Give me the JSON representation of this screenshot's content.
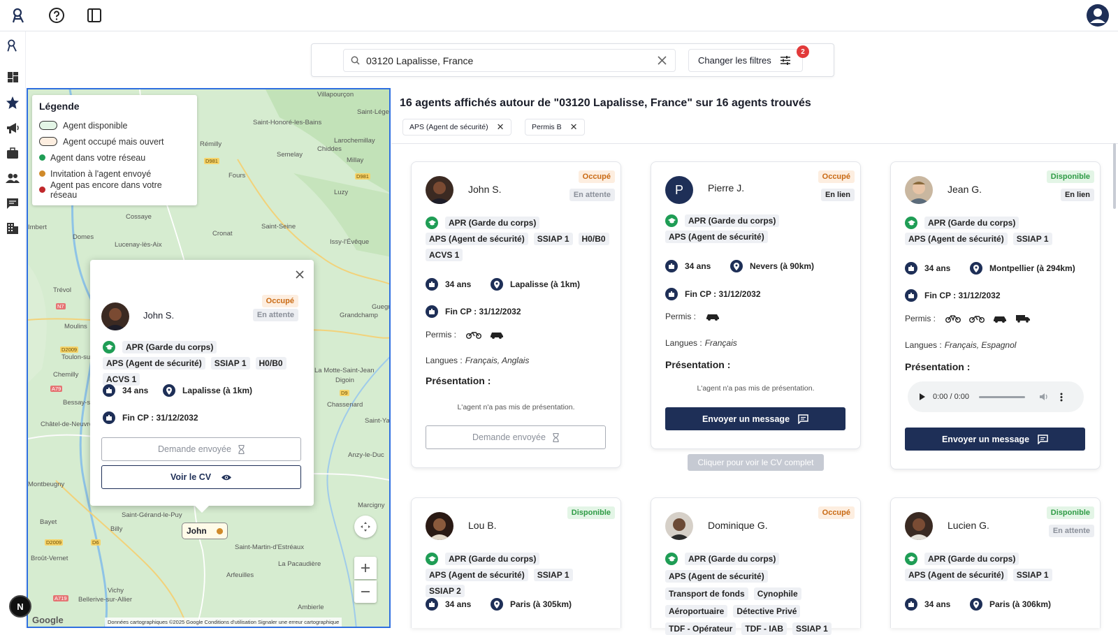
{
  "app": {
    "logo": "logo-icon",
    "help": "help-icon",
    "panel": "sidebar-toggle-icon",
    "profile": "user-avatar-icon"
  },
  "sidebar": {
    "items": [
      "logo",
      "dashboard",
      "map-star",
      "megaphone",
      "briefcase",
      "users",
      "messages",
      "building"
    ]
  },
  "search": {
    "value": "03120 Lapalisse, France",
    "filter_label": "Changer les filtres",
    "filter_count": "2"
  },
  "legend": {
    "title": "Légende",
    "items": [
      "Agent disponible",
      "Agent occupé mais ouvert",
      "Agent dans votre réseau",
      "Invitation à l'agent envoyé",
      "Agent pas encore dans votre réseau"
    ]
  },
  "map": {
    "towns": [
      "Villapourçon",
      "Saint-Léger",
      "Saint-Honoré-les-Bains",
      "Larochemillay",
      "Rémilly",
      "Semelay",
      "Chiddes",
      "Millay",
      "Fours",
      "Luzy",
      "Cossaye",
      "Saint-Seine",
      "Imbert",
      "Domes",
      "Lucenay-lès-Aix",
      "Cronat",
      "Issy-l'Évêque",
      "Trévol",
      "Moulins",
      "Guegnon",
      "Grandchamp",
      "Toulon-sur-Allier",
      "Chemilly",
      "La Motte-Saint-Jean",
      "Digoin",
      "Bessay-sur-Allier",
      "Chassenard",
      "Saint-Yan",
      "Châtel-de-Neuvre",
      "Anzy-le-Duc",
      "Montbeugny",
      "Marcigny",
      "Bayet",
      "Saint-Gérand-le-Puy",
      "Billy",
      "Saint-Martin-d'Estréaux",
      "Broût-Vernet",
      "La Pacaudière",
      "Arfeuilles",
      "Vichy",
      "Bellerive-sur-Allier",
      "Ambierle"
    ],
    "roads": [
      "D981",
      "N7",
      "D2009",
      "A79",
      "D9",
      "D2009",
      "D6",
      "A719",
      "D981"
    ],
    "marker": "John",
    "attribution": "Données cartographiques ©2025 Google    Conditions d'utilisation    Signaler une erreur cartographique",
    "google": "Google"
  },
  "popup": {
    "name": "John S.",
    "status": "Occupé",
    "link": "En attente",
    "cert": "APR (Garde du corps)",
    "tags": [
      "APS (Agent de sécurité)",
      "SSIAP 1",
      "H0/B0",
      "ACVS 1"
    ],
    "age": "34 ans",
    "location": "Lapalisse (à 1km)",
    "fin": "Fin CP : 31/12/2032",
    "request": "Demande envoyée",
    "cv": "Voir le CV"
  },
  "results": {
    "title": "16 agents affichés autour de \"03120 Lapalisse, France\" sur 16 agents trouvés",
    "chips": [
      "APS (Agent de sécurité)",
      "Permis B"
    ],
    "cv_hint": "Cliquer pour voir le CV complet"
  },
  "labels": {
    "permis": "Permis :",
    "langues": "Langues :",
    "presentation": "Présentation :",
    "no_pres": "L'agent n'a pas mis de présentation.",
    "message": "Envoyer un message",
    "request": "Demande envoyée",
    "audio_time": "0:00 / 0:00"
  },
  "cards": [
    {
      "name": "John S.",
      "status": "Occupé",
      "link": "En attente",
      "cert": "APR (Garde du corps)",
      "tags": [
        "APS (Agent de sécurité)",
        "SSIAP 1",
        "H0/B0",
        "ACVS 1"
      ],
      "age": "34 ans",
      "location": "Lapalisse (à 1km)",
      "fin": "Fin CP : 31/12/2032",
      "langues": "Français, Anglais"
    },
    {
      "name": "Pierre J.",
      "initial": "P",
      "status": "Occupé",
      "link": "En lien",
      "cert": "APR (Garde du corps)",
      "tags": [
        "APS (Agent de sécurité)"
      ],
      "age": "34 ans",
      "location": "Nevers (à 90km)",
      "fin": "Fin CP : 31/12/2032",
      "langues": "Français"
    },
    {
      "name": "Jean G.",
      "status": "Disponible",
      "link": "En lien",
      "cert": "APR (Garde du corps)",
      "tags": [
        "APS (Agent de sécurité)",
        "SSIAP 1"
      ],
      "age": "34 ans",
      "location": "Montpellier (à 294km)",
      "fin": "Fin CP : 31/12/2032",
      "langues": "Français, Espagnol"
    },
    {
      "name": "Lou B.",
      "status": "Disponible",
      "cert": "APR (Garde du corps)",
      "tags": [
        "APS (Agent de sécurité)",
        "SSIAP 1",
        "SSIAP 2"
      ],
      "age": "34 ans",
      "location": "Paris (à 305km)"
    },
    {
      "name": "Dominique G.",
      "status": "Occupé",
      "cert": "APR (Garde du corps)",
      "tags": [
        "APS (Agent de sécurité)",
        "Transport de fonds",
        "Cynophile",
        "Aéroportuaire",
        "Détective Privé",
        "TDF - Opérateur",
        "TDF - IAB",
        "SSIAP 1"
      ],
      "age": "34 ans"
    },
    {
      "name": "Lucien G.",
      "status": "Disponible",
      "link": "En attente",
      "cert": "APR (Garde du corps)",
      "tags": [
        "APS (Agent de sécurité)",
        "SSIAP 1"
      ],
      "age": "34 ans",
      "location": "Paris (à 306km)"
    }
  ],
  "colors": {
    "primary": "#1e2f57",
    "available": "#2e9b45",
    "busy": "#c96a14",
    "network": "#1f9d55",
    "invited": "#d08a2a",
    "not_network": "#c0282b",
    "map_border": "#2f6fe0"
  }
}
